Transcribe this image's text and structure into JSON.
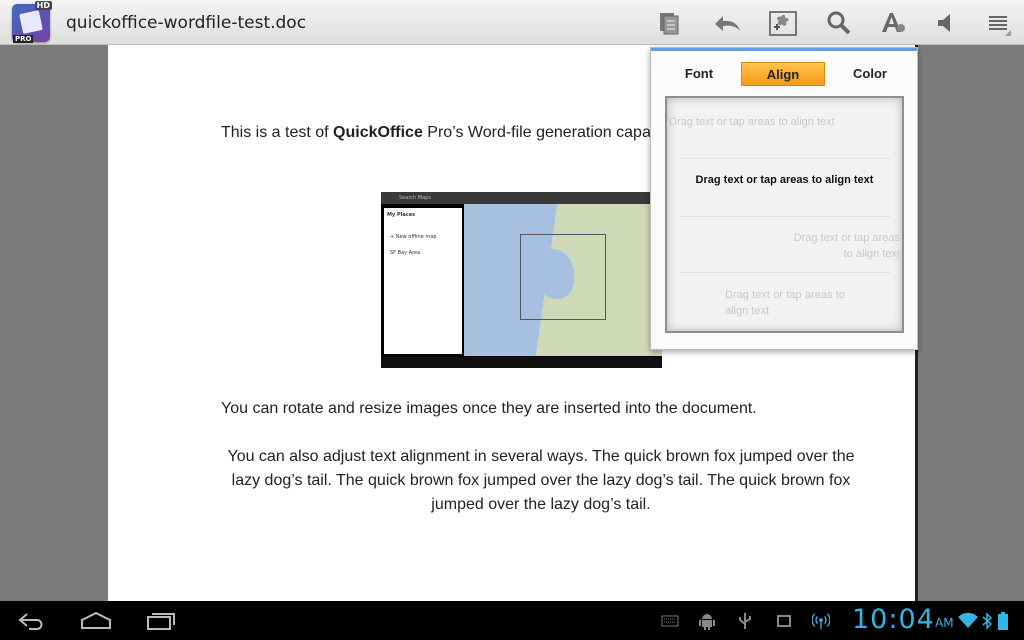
{
  "app": {
    "icon_name": "quickoffice-app-icon",
    "badge_hd": "HD",
    "badge_pro": "PRO",
    "document_title": "quickoffice-wordfile-test.doc"
  },
  "toolbar": {
    "icons": [
      "document-pages-icon",
      "undo-icon",
      "insert-image-icon",
      "search-icon",
      "text-format-icon",
      "speaker-icon",
      "menu-icon"
    ]
  },
  "document": {
    "p1_prefix": "This is a test of ",
    "p1_bold": "QuickOffice",
    "p1_suffix": " Pro’s Word-file generation capabilities, text and paragraph style formatting capabilities.",
    "p2": "You can rotate and resize images once they are inserted into the document.",
    "p3": "You can also adjust text alignment in several ways.  The quick brown fox jumped over the lazy dog’s tail. The quick brown fox jumped over the lazy dog’s tail. The quick brown fox jumped over the lazy dog’s tail.",
    "image": {
      "search_placeholder": "Search Maps",
      "side_title": "My Places",
      "side_item_1": "+ New offline map",
      "side_item_2": "SF Bay Area"
    }
  },
  "align_popup": {
    "tabs": [
      {
        "label": "Font",
        "active": false
      },
      {
        "label": "Align",
        "active": true
      },
      {
        "label": "Color",
        "active": false
      }
    ],
    "options": {
      "left": "Drag text or tap areas to align text",
      "center": "Drag text or tap areas to align text",
      "right_line1": "Drag text or tap areas",
      "right_line2": "to align text",
      "justify": "Drag text or tap areas to align text"
    },
    "accent_color": "#f39a18"
  },
  "system_bar": {
    "time": "10:04",
    "ampm": "AM",
    "clock_color": "#33b5e5",
    "nav": [
      "back-icon",
      "home-icon",
      "recent-apps-icon"
    ],
    "status": [
      "keyboard-icon",
      "android-debug-icon",
      "usb-icon",
      "screenshot-icon",
      "hotspot-icon",
      "wifi-icon",
      "bluetooth-icon",
      "battery-icon"
    ]
  }
}
